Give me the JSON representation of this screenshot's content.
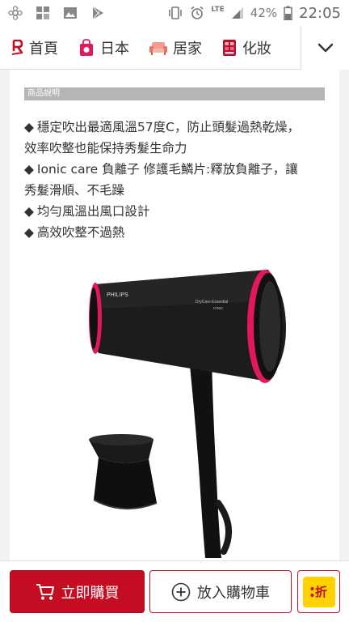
{
  "status_bar": {
    "network": "LTE",
    "battery": "42%",
    "time": "22:05"
  },
  "nav": {
    "items": [
      {
        "label": "首頁",
        "icon": "rakuten-r-icon"
      },
      {
        "label": "日本",
        "icon": "japan-bag-icon"
      },
      {
        "label": "居家",
        "icon": "sofa-icon"
      },
      {
        "label": "化妝",
        "icon": "cosmetics-palette-icon"
      }
    ],
    "more_icon": "chevron-down-icon"
  },
  "product_info": {
    "section_label": "商品說明",
    "bullet": "◆",
    "features": [
      "穩定吹出最適風溫57度C，防止頭髮過熱乾燥，",
      "效率吹整也能保持秀髮生命力",
      "Ionic care 負離子 修護毛鱗片:釋放負離子，讓",
      "秀髮滑順、不毛躁",
      "均勻風溫出風口設計",
      "高效吹整不過熱"
    ]
  },
  "product_image": {
    "brand": "PHILIPS",
    "model_line": "DryCare Essential",
    "feature": "IONIC"
  },
  "bottom_bar": {
    "buy_now": "立即購買",
    "add_to_cart": "放入購物車",
    "discount_char": "折"
  },
  "colors": {
    "brand_red": "#c40d22",
    "accent_pink": "#e2185a",
    "discount_yellow": "#ffd200"
  }
}
